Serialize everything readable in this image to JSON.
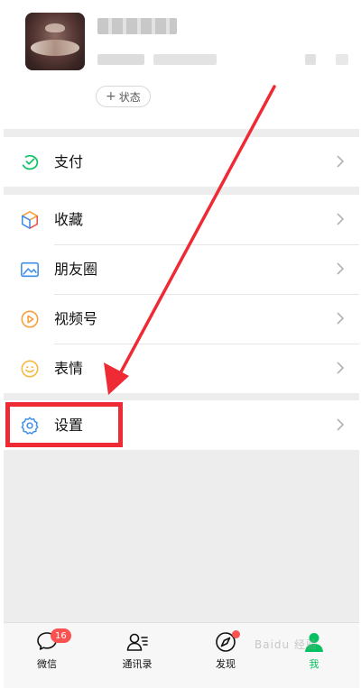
{
  "profile": {
    "status_button_label": "状态",
    "status_plus": "+"
  },
  "menu": {
    "pay": "支付",
    "favorites": "收藏",
    "moments": "朋友圈",
    "channels": "视频号",
    "stickers": "表情",
    "settings": "设置"
  },
  "tabbar": {
    "tabs": [
      {
        "label": "微信",
        "icon": "chat-icon",
        "badge": "16"
      },
      {
        "label": "通讯录",
        "icon": "contacts-icon"
      },
      {
        "label": "发现",
        "icon": "compass-icon",
        "dot": true
      },
      {
        "label": "我",
        "icon": "me-icon",
        "active": true
      }
    ]
  },
  "colors": {
    "accent_green": "#07c160",
    "annotation_red": "#ee2b35",
    "badge_red": "#fa5151"
  }
}
